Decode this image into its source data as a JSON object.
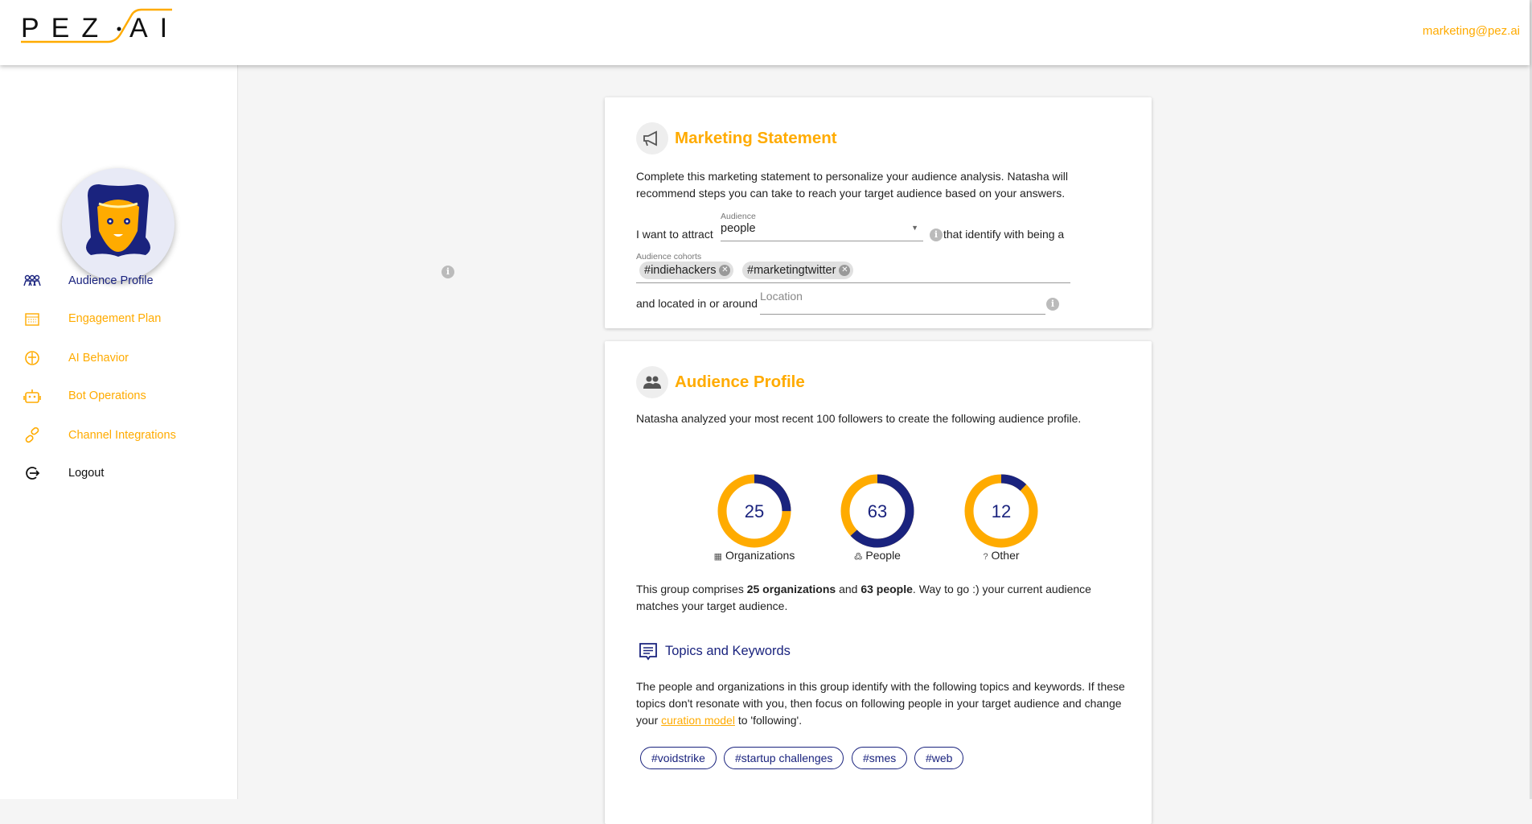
{
  "header": {
    "logo": "PEZ·AI",
    "user_email": "marketing@pez.ai"
  },
  "sidebar": {
    "items": [
      {
        "label": "Audience Profile",
        "icon": "audience-icon"
      },
      {
        "label": "Engagement Plan",
        "icon": "calendar-icon"
      },
      {
        "label": "AI Behavior",
        "icon": "brain-icon"
      },
      {
        "label": "Bot Operations",
        "icon": "robot-icon"
      },
      {
        "label": "Channel Integrations",
        "icon": "link-icon"
      },
      {
        "label": "Logout",
        "icon": "logout-icon"
      }
    ]
  },
  "marketing": {
    "title": "Marketing Statement",
    "description": "Complete this marketing statement to personalize your audience analysis. Natasha will recommend steps you can take to reach your target audience based on your answers.",
    "attract_prefix": "I want to attract",
    "audience_label": "Audience",
    "audience_value": "people",
    "identify_suffix": "that identify with being a",
    "cohorts_label": "Audience cohorts",
    "cohorts": [
      "#indiehackers",
      "#marketingtwitter"
    ],
    "location_prefix": "and located in or around",
    "location_placeholder": "Location",
    "info": "i"
  },
  "profile": {
    "title": "Audience Profile",
    "description": "Natasha analyzed your most recent 100 followers to create the following audience profile.",
    "summary_1": "This group comprises ",
    "summary_bold_1": "25 organizations",
    "summary_2": " and ",
    "summary_bold_2": "63 people",
    "summary_3": ". Way to go :) your current audience matches your target audience.",
    "topics_title": "Topics and Keywords",
    "topics_text_1": "The people and organizations in this group identify with the following topics and keywords. If these topics don't resonate with you, then focus on following people in your target audience and change your ",
    "topics_link": "curation model",
    "topics_text_2": " to 'following'.",
    "topics": [
      "#voidstrike",
      "#startup challenges",
      "#smes",
      "#web"
    ]
  },
  "chart_data": {
    "type": "pie",
    "categories": [
      "Organizations",
      "People",
      "Other"
    ],
    "values": [
      25,
      63,
      12
    ],
    "colors": {
      "value": "#1a237e",
      "remainder": "#ffab00"
    }
  }
}
